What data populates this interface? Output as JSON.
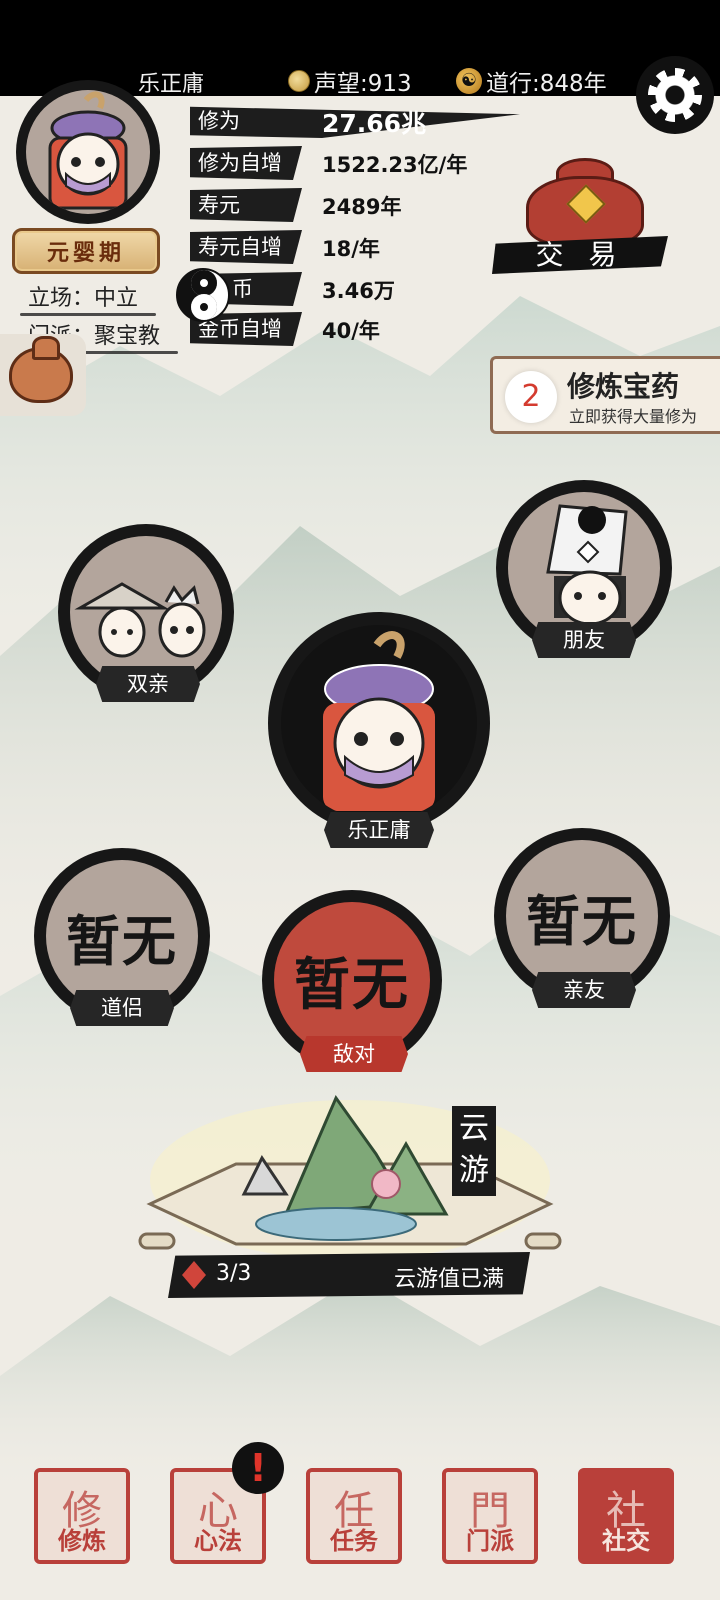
{
  "status_bar": {
    "player_name": "乐正庸",
    "reputation": "声望:913",
    "dao_years": "道行:848年"
  },
  "profile": {
    "realm": "元婴期",
    "stance": "立场：中立",
    "sect": "门派：聚宝教"
  },
  "stats": [
    {
      "label": "修为",
      "value": "27.66兆"
    },
    {
      "label": "修为自增",
      "value": "1522.23亿/年"
    },
    {
      "label": "寿元",
      "value": "2489年"
    },
    {
      "label": "寿元自增",
      "value": "18/年"
    },
    {
      "label": "币",
      "value": "3.46万"
    },
    {
      "label": "金币自增",
      "value": "40/年"
    }
  ],
  "trade": {
    "label": "交 易"
  },
  "elixir": {
    "count": "2",
    "title": "修炼宝药",
    "subtitle": "立即获得大量修为"
  },
  "relations": {
    "parents": {
      "label": "双亲"
    },
    "friend": {
      "label": "朋友"
    },
    "self": {
      "label": "乐正庸"
    },
    "partner": {
      "label": "道侣",
      "placeholder": "暂无"
    },
    "enemy": {
      "label": "敌对",
      "placeholder": "暂无"
    },
    "relative": {
      "label": "亲友",
      "placeholder": "暂无"
    }
  },
  "travel": {
    "tag": "云游",
    "count": "3/3",
    "status": "云游值已满"
  },
  "nav": [
    {
      "label": "修炼",
      "glyph": "修",
      "active": false
    },
    {
      "label": "心法",
      "glyph": "心",
      "active": false
    },
    {
      "label": "任务",
      "glyph": "任",
      "active": false
    },
    {
      "label": "门派",
      "glyph": "門",
      "active": false
    },
    {
      "label": "社交",
      "glyph": "社",
      "active": true
    }
  ],
  "notification": {
    "mark": "!"
  },
  "colors": {
    "accent_red": "#b9403a",
    "ink": "#1d1d1d",
    "paper": "#efece5"
  }
}
